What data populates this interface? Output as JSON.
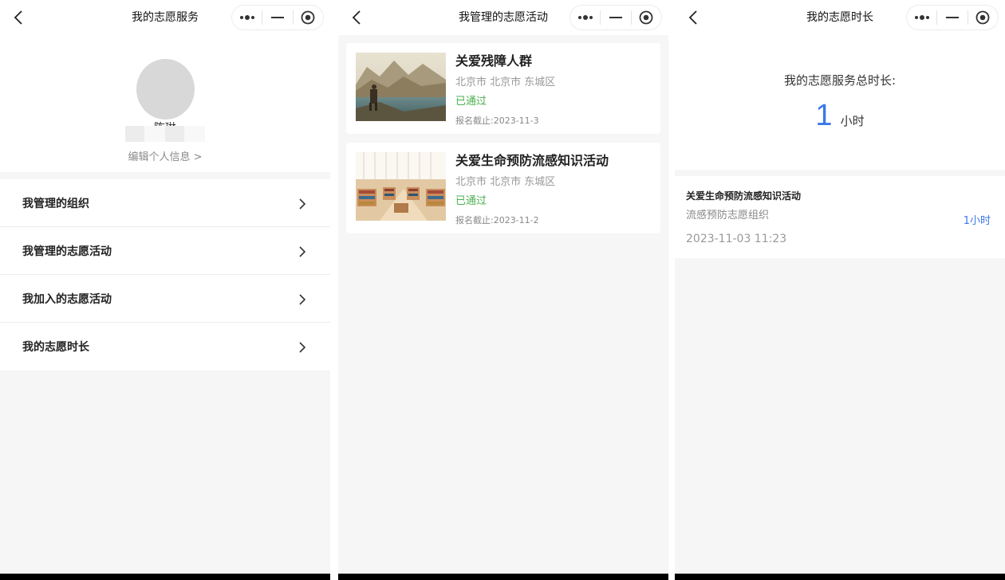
{
  "screen_service": {
    "title": "我的志愿服务",
    "username": "陈琳",
    "edit_link": "编辑个人信息 >",
    "menu": [
      {
        "label": "我管理的组织"
      },
      {
        "label": "我管理的志愿活动"
      },
      {
        "label": "我加入的志愿活动"
      },
      {
        "label": "我的志愿时长"
      }
    ]
  },
  "screen_activities": {
    "title": "我管理的志愿活动",
    "cards": [
      {
        "title": "关爱残障人群",
        "location": "北京市 北京市 东城区",
        "status": "已通过",
        "deadline": "报名截止:2023-11-3",
        "image": "mountain-lake-hiker-photo"
      },
      {
        "title": "关爱生命预防流感知识活动",
        "location": "北京市 北京市 东城区",
        "status": "已通过",
        "deadline": "报名截止:2023-11-2",
        "image": "library-interior-photo"
      }
    ]
  },
  "screen_hours": {
    "title": "我的志愿时长",
    "total_label": "我的志愿服务总时长:",
    "total_value": "1",
    "total_unit": "小时",
    "records": [
      {
        "title": "关爱生命预防流感知识活动",
        "org": "流感预防志愿组织",
        "hours": "1小时",
        "date": "2023-11-03 11:23"
      }
    ]
  },
  "capsule": {
    "more_icon": "more-dots-icon",
    "minimize_icon": "minimize-icon",
    "close_icon": "target-circle-icon"
  },
  "colors": {
    "accent_blue": "#3b78e7",
    "status_green": "#4caf50",
    "background": "#f6f6f6"
  }
}
